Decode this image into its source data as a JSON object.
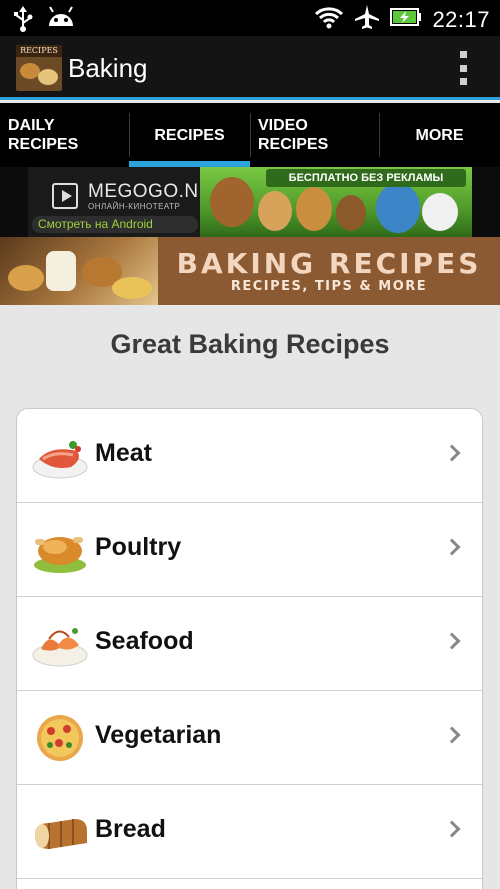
{
  "status_bar": {
    "time": "22:17",
    "icons": [
      "usb-icon",
      "android-icon",
      "wifi-icon",
      "airplane-icon",
      "battery-charging-icon"
    ]
  },
  "action_bar": {
    "title": "Baking",
    "logo_text": "RECIPES",
    "overflow_icon": "overflow-menu-icon"
  },
  "tabs": [
    {
      "line1": "DAILY",
      "line2": "RECIPES",
      "active": false
    },
    {
      "line1": "RECIPES",
      "line2": "",
      "active": true
    },
    {
      "line1": "VIDEO",
      "line2": "RECIPES",
      "active": false
    },
    {
      "line1": "MORE",
      "line2": "",
      "active": false
    }
  ],
  "ad": {
    "brand": "MEGOGO.NET",
    "subtitle": "ОНЛАЙН-КИНОТЕАТР",
    "android_text": "Смотреть на Android",
    "tagline": "БЕСПЛАТНО БЕЗ РЕКЛАМЫ"
  },
  "hero": {
    "title": "BAKING RECIPES",
    "subtitle": "RECIPES, TIPS & MORE"
  },
  "content": {
    "heading": "Great Baking Recipes",
    "categories": [
      {
        "label": "Meat",
        "icon": "meat-dish-icon"
      },
      {
        "label": "Poultry",
        "icon": "roast-chicken-icon"
      },
      {
        "label": "Seafood",
        "icon": "shrimp-dish-icon"
      },
      {
        "label": "Vegetarian",
        "icon": "pizza-icon"
      },
      {
        "label": "Bread",
        "icon": "bread-loaf-icon"
      }
    ]
  },
  "colors": {
    "accent": "#2ca3dc",
    "heading": "#3a3a3a",
    "hero_text": "#f3d6c0"
  }
}
